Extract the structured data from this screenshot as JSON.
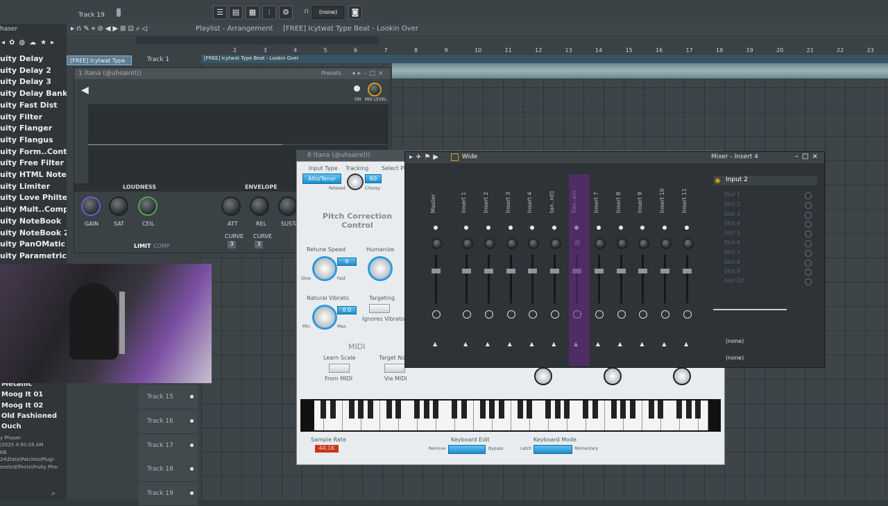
{
  "topbar": {
    "track_label": "Track 19",
    "pattern_selector": "(none)"
  },
  "playlist": {
    "title": "Playlist - Arrangement",
    "breadcrumb": "[FREE] Icytwat Type Beat - Lookin Over",
    "clip_label": "[FREE] Icytwat Type",
    "track1_label": "Track 1",
    "audio_clip_name": "[FREE] Icytwat Type Beat - Lookin Over",
    "ruler": [
      "2",
      "3",
      "4",
      "5",
      "6",
      "7",
      "8",
      "9",
      "10",
      "11",
      "12",
      "13",
      "14",
      "15",
      "16",
      "17",
      "18",
      "19",
      "20",
      "21",
      "22",
      "23"
    ],
    "tracks": [
      "Track 15",
      "Track 16",
      "Track 17",
      "Track 18",
      "Track 19"
    ]
  },
  "browser": {
    "items_top": [
      "uity Delay",
      "uity Delay 2",
      "uity Delay 3",
      "uity Delay Bank",
      "uity Fast Dist",
      "uity Filter",
      "uity Flanger",
      "uity Flangus",
      "uity Form..Controller",
      "uity Free Filter",
      "uity HTML NoteBook",
      "uity Limiter",
      "uity Love Philter",
      "uity Mult..Compressor",
      "uity NoteBook",
      "uity NoteBook 2",
      "uity PanOMatic",
      "uity Parametric EQ"
    ],
    "items_bottom": [
      "Metallic",
      "Moog It 01",
      "Moog It 02",
      "Old Fashioned",
      "Ouch"
    ],
    "info_lines": [
      "y Phaser",
      "/2025 4:50:18 AM",
      "KB",
      "24\\Data\\Patches\\Plugi-",
      "esets\\Effects\\Fruity Pha-"
    ],
    "header_label": "haser"
  },
  "limiter": {
    "title": "1 (tana (@uhsaintl))",
    "presets_label": "Presets",
    "on_label": "ON",
    "mix_label": "MIX LEVEL",
    "loudness_label": "LOUDNESS",
    "envelope_label": "ENVELOPE",
    "knobs": [
      "GAIN",
      "SAT",
      "CEIL",
      "ATT",
      "REL",
      "SUSTA"
    ],
    "curve_label": "CURVE",
    "curve_values": [
      "3",
      "3"
    ],
    "mode_limit": "LIMIT",
    "mode_comp": "COMP"
  },
  "pitch": {
    "title": "8 (tana (@uhsaintl))",
    "input_type_label": "Input Type",
    "input_type_value": "Alto/Tenor",
    "tracking_label": "Tracking",
    "tracking_value": "60",
    "relaxed": "Relaxed",
    "choosy": "Choosy",
    "pitch_label": "Select Pi",
    "section_title": "Pitch Correction Control",
    "retune_label": "Retune Speed",
    "retune_value": "6",
    "slow": "Slow",
    "fast": "Fast",
    "humanize_label": "Humanize",
    "vibrato_label": "Natural Vibrato",
    "vibrato_value": "0.0",
    "min": "Min.",
    "max": "Max.",
    "targeting_label": "Targeting",
    "ignores_vibrato": "Ignores Vibrato",
    "midi_label": "MIDI",
    "learn_scale": "Learn Scale",
    "from_midi": "From MIDI",
    "target_notes": "Target No",
    "via_midi": "Via MIDI",
    "sample_rate_label": "Sample Rate",
    "sample_rate_value": "44.1K",
    "keyboard_edit_label": "Keyboard Edit",
    "remove": "Remove",
    "bypass": "Bypass",
    "keyboard_mode_label": "Keyboard Mode",
    "latch": "Latch",
    "momentary": "Momentary"
  },
  "mixer": {
    "view_label": "Wide",
    "insert_title": "Mixer - Insert 4",
    "input_label": "Input 2",
    "strip_names": [
      "Master",
      "Insert 1",
      "Insert 2",
      "Insert 3",
      "Insert 4",
      "tan..ntl)",
      "flan..ain",
      "Insert 7",
      "Insert 8",
      "Insert 9",
      "Insert 10",
      "Insert 11"
    ],
    "slots": [
      "Slot 1",
      "Slot 2",
      "Slot 3",
      "Slot 4",
      "Slot 5",
      "Slot 6",
      "Slot 7",
      "Slot 8",
      "Slot 9",
      "Slot 10"
    ],
    "eq_label": "(none)",
    "out_label": "(none)"
  }
}
